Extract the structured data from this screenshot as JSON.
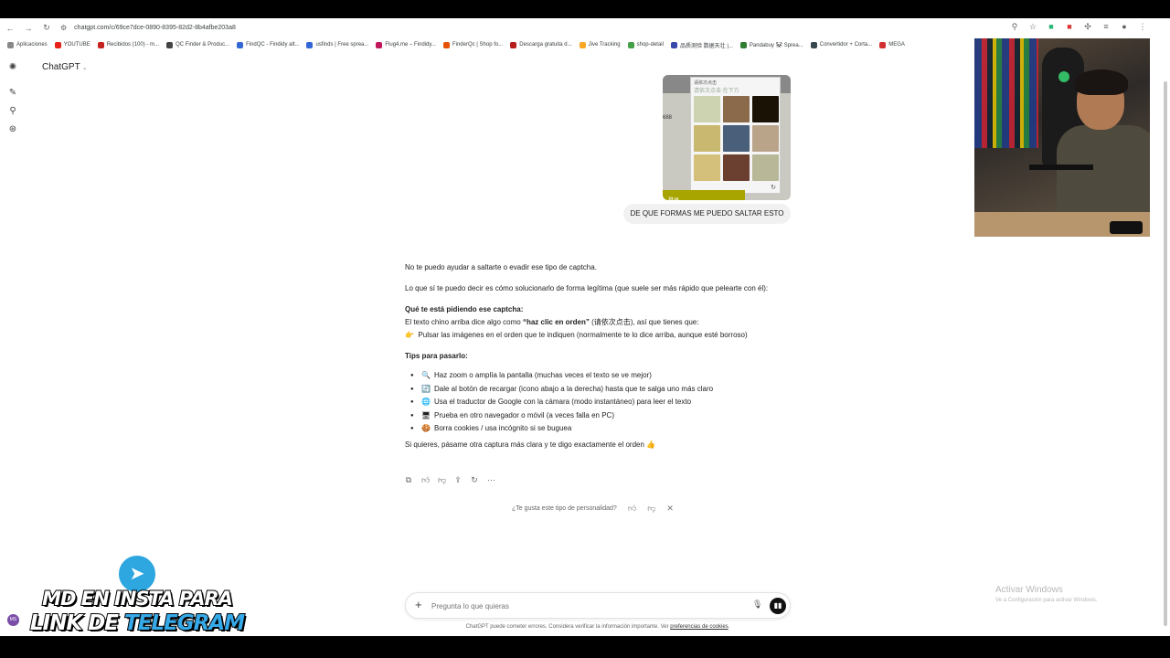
{
  "browser": {
    "url": "chatgpt.com/c/69ce7dce-0890-8395-82d2-8b4afbe203a8",
    "bookmarks": [
      {
        "label": "Aplicaciones",
        "color": "#888888"
      },
      {
        "label": "YOUTUBE",
        "color": "#e62117"
      },
      {
        "label": "Recibidos (100) - m...",
        "color": "#c5221f"
      },
      {
        "label": "QC Finder & Produc...",
        "color": "#444444"
      },
      {
        "label": "FindQC - Findidy alt...",
        "color": "#3367d6"
      },
      {
        "label": "usfinds | Free sprea...",
        "color": "#3367d6"
      },
      {
        "label": "Flug4.me – Findidy...",
        "color": "#c2185b"
      },
      {
        "label": "FinderQc | Shop fo...",
        "color": "#e65100"
      },
      {
        "label": "Descarga gratuita d...",
        "color": "#b71c1c"
      },
      {
        "label": "Jive Tracking",
        "color": "#f9a825"
      },
      {
        "label": "shop-detail",
        "color": "#43a047"
      },
      {
        "label": "品质测验 数据天壮 |...",
        "color": "#3949ab"
      },
      {
        "label": "Pandabuy 🐼 Sprea...",
        "color": "#2e7d32"
      },
      {
        "label": "Convertidor + Corta...",
        "color": "#37474f"
      },
      {
        "label": "MEGA",
        "color": "#d32f2f"
      }
    ]
  },
  "sidebar": {
    "brand": "ChatGPT"
  },
  "conversation": {
    "captcha_image": {
      "header_title": "请依次点击",
      "header_text": "请依次点击 在下方",
      "side_text": "688",
      "footer_text": "登录",
      "tile_colors": [
        "#cdd3b0",
        "#8a6a4a",
        "#1b1206",
        "#c9b870",
        "#4a5f7a",
        "#b9a48a",
        "#d4c07a",
        "#6b4030",
        "#b8b898"
      ]
    },
    "user_message": "DE QUE FORMAS ME PUEDO SALTAR ESTO",
    "answer": {
      "p1": "No te puedo ayudar a saltarte o evadir ese tipo de captcha.",
      "p2": "Lo que sí te puedo decir es cómo solucionarlo de forma legítima (que suele ser más rápido que pelearte con él):",
      "h1": "Qué te está pidiendo ese captcha:",
      "p3_pre": "El texto chino arriba dice algo como ",
      "p3_bold": "“haz clic en orden”",
      "p3_post": " (请依次点击), así que tienes que:",
      "p4_emoji": "👉",
      "p4": "Pulsar las imágenes en el orden que te indiquen (normalmente te lo dice arriba, aunque esté borroso)",
      "h2": "Tips para pasarlo:",
      "tips": [
        {
          "emoji": "🔍",
          "text": "Haz zoom o amplía la pantalla (muchas veces el texto se ve mejor)"
        },
        {
          "emoji": "🔄",
          "text": "Dale al botón de recargar (icono abajo a la derecha) hasta que te salga uno más claro"
        },
        {
          "emoji": "🌐",
          "text": "Usa el traductor de Google con la cámara (modo instantáneo) para leer el texto"
        },
        {
          "emoji": "🖥",
          "text": "Prueba en otro navegador o móvil (a veces falla en PC)"
        },
        {
          "emoji": "🍪",
          "text": "Borra cookies / usa incógnito si se buguea"
        }
      ],
      "closing": "Si quieres, pásame otra captura más clara y te digo exactamente el orden 👍"
    },
    "feedback_prompt": "¿Te gusta este tipo de personalidad?"
  },
  "composer": {
    "placeholder": "Pregunta lo que quieras",
    "disclaimer_pre": "ChatGPT puede cometer errores. Considera verificar la información importante. Ver ",
    "disclaimer_link": "preferencias de cookies",
    "disclaimer_post": "."
  },
  "windows_watermark": {
    "title": "Activar Windows",
    "subtitle": "Ve a Configuración para activar Windows."
  },
  "promo": {
    "line1": "MD EN INSTA PARA",
    "line2_a": "LINK DE ",
    "line2_b": "TELEGRAM",
    "avatar_text": "MS"
  },
  "colors": {
    "telegram_blue": "#2ea6e0",
    "voice_button": "#111111"
  }
}
